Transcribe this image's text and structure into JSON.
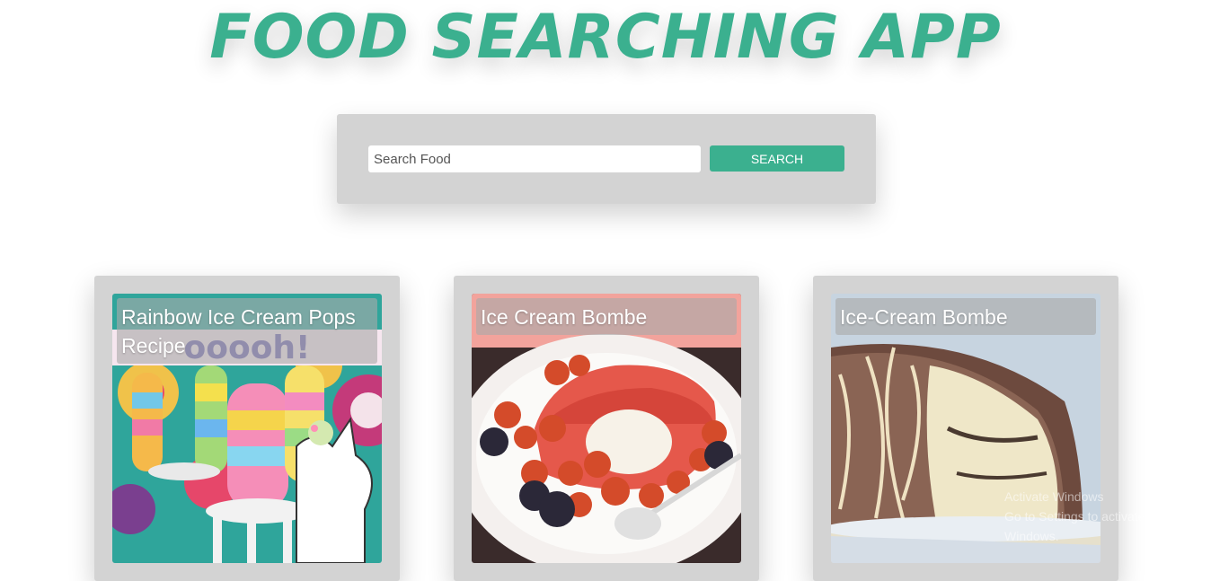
{
  "header": {
    "title": "FOOD SEARCHING APP"
  },
  "search": {
    "placeholder": "Search Food",
    "button_label": "SEARCH"
  },
  "results": [
    {
      "title": "Rainbow Ice Cream Pops Recipe"
    },
    {
      "title": "Ice Cream Bombe"
    },
    {
      "title": "Ice-Cream Bombe"
    }
  ],
  "watermark": {
    "line1": "Activate Windows",
    "line2": "Go to Settings to activate Windows."
  },
  "colors": {
    "accent": "#3bb08f",
    "panel": "#d3d3d3",
    "background": "#ffffff"
  }
}
